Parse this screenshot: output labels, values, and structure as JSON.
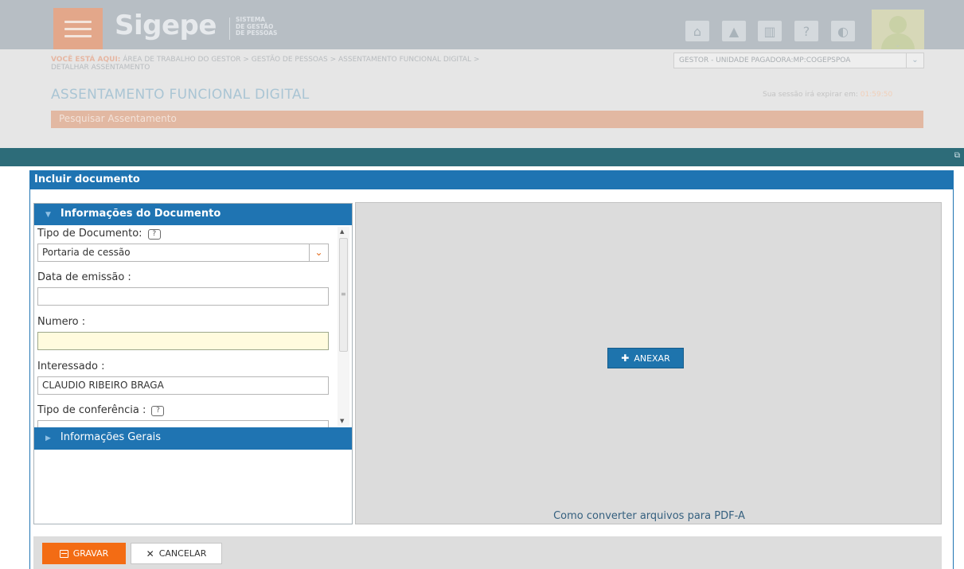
{
  "app": {
    "logo": "Sigepe",
    "logo_sub": [
      "SISTEMA",
      "DE GESTÃO",
      "DE PESSOAS"
    ],
    "header_icons": [
      "home-icon",
      "bell-icon",
      "book-icon",
      "help-icon",
      "contrast-icon"
    ],
    "breadcrumb_prefix": "VOCÊ ESTÁ AQUI:",
    "breadcrumb_line1": "ÁREA DE TRABALHO DO GESTOR > GESTÃO DE PESSOAS > ASSENTAMENTO FUNCIONAL DIGITAL >",
    "breadcrumb_line2": "DETALHAR ASSENTAMENTO",
    "role_select": "GESTOR - UNIDADE PAGADORA:MP:COGEPSPOA",
    "page_title": "ASSENTAMENTO FUNCIONAL DIGITAL",
    "session_label": "Sua sessão irá expirar em:",
    "session_time": "01:59:50",
    "search_bar": "Pesquisar Assentamento"
  },
  "modal": {
    "title": "Incluir documento",
    "section_info": "Informações do Documento",
    "section_general": "Informações Gerais",
    "tipo_documento_label": "Tipo de Documento:",
    "tipo_documento_value": "Portaria de cessão",
    "data_emissao_label": "Data de emissão :",
    "data_emissao_value": "",
    "numero_label": "Numero :",
    "numero_value": "",
    "interessado_label": "Interessado :",
    "interessado_value": "CLAUDIO RIBEIRO BRAGA",
    "tipo_conferencia_label": "Tipo de conferência :",
    "anexar_label": "ANEXAR",
    "pdf_link": "Como converter arquivos para PDF-A",
    "gravar_label": "GRAVAR",
    "cancelar_label": "CANCELAR"
  },
  "colors": {
    "modal_blue": "#1f74b2",
    "teal_bar": "#2d6c79",
    "orange": "#f36c14"
  }
}
